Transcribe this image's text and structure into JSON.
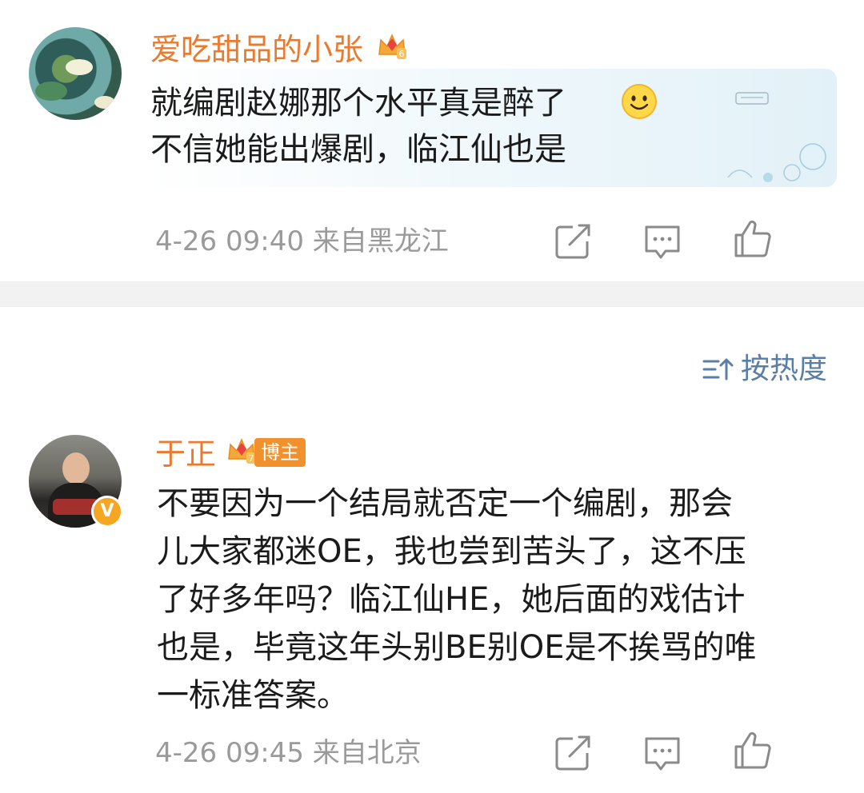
{
  "posts": [
    {
      "username": "爱吃甜品的小张",
      "text_lines": [
        "就编剧赵娜那个水平真是醉了",
        "不信她能出爆剧，临江仙也是"
      ],
      "emoji": "smiley-face",
      "meta": "4-26 09:40 来自黑龙江",
      "member_level": "6"
    },
    {
      "username": "于正",
      "badge": "博主",
      "member_level": "7",
      "text_lines": [
        "不要因为一个结局就否定一个编剧，那会",
        "儿大家都迷OE，我也尝到苦头了，这不压",
        "了好多年吗？临江仙HE，她后面的戏估计",
        "也是，毕竟这年头别BE别OE是不挨骂的唯",
        "一标准答案。"
      ],
      "meta": "4-26 09:45 来自北京"
    }
  ],
  "sort": {
    "label": "按热度"
  },
  "colors": {
    "username": "#ea7a2e",
    "meta": "#9a9a9a",
    "sort": "#5a7ea6",
    "badge": "#f0912e"
  }
}
